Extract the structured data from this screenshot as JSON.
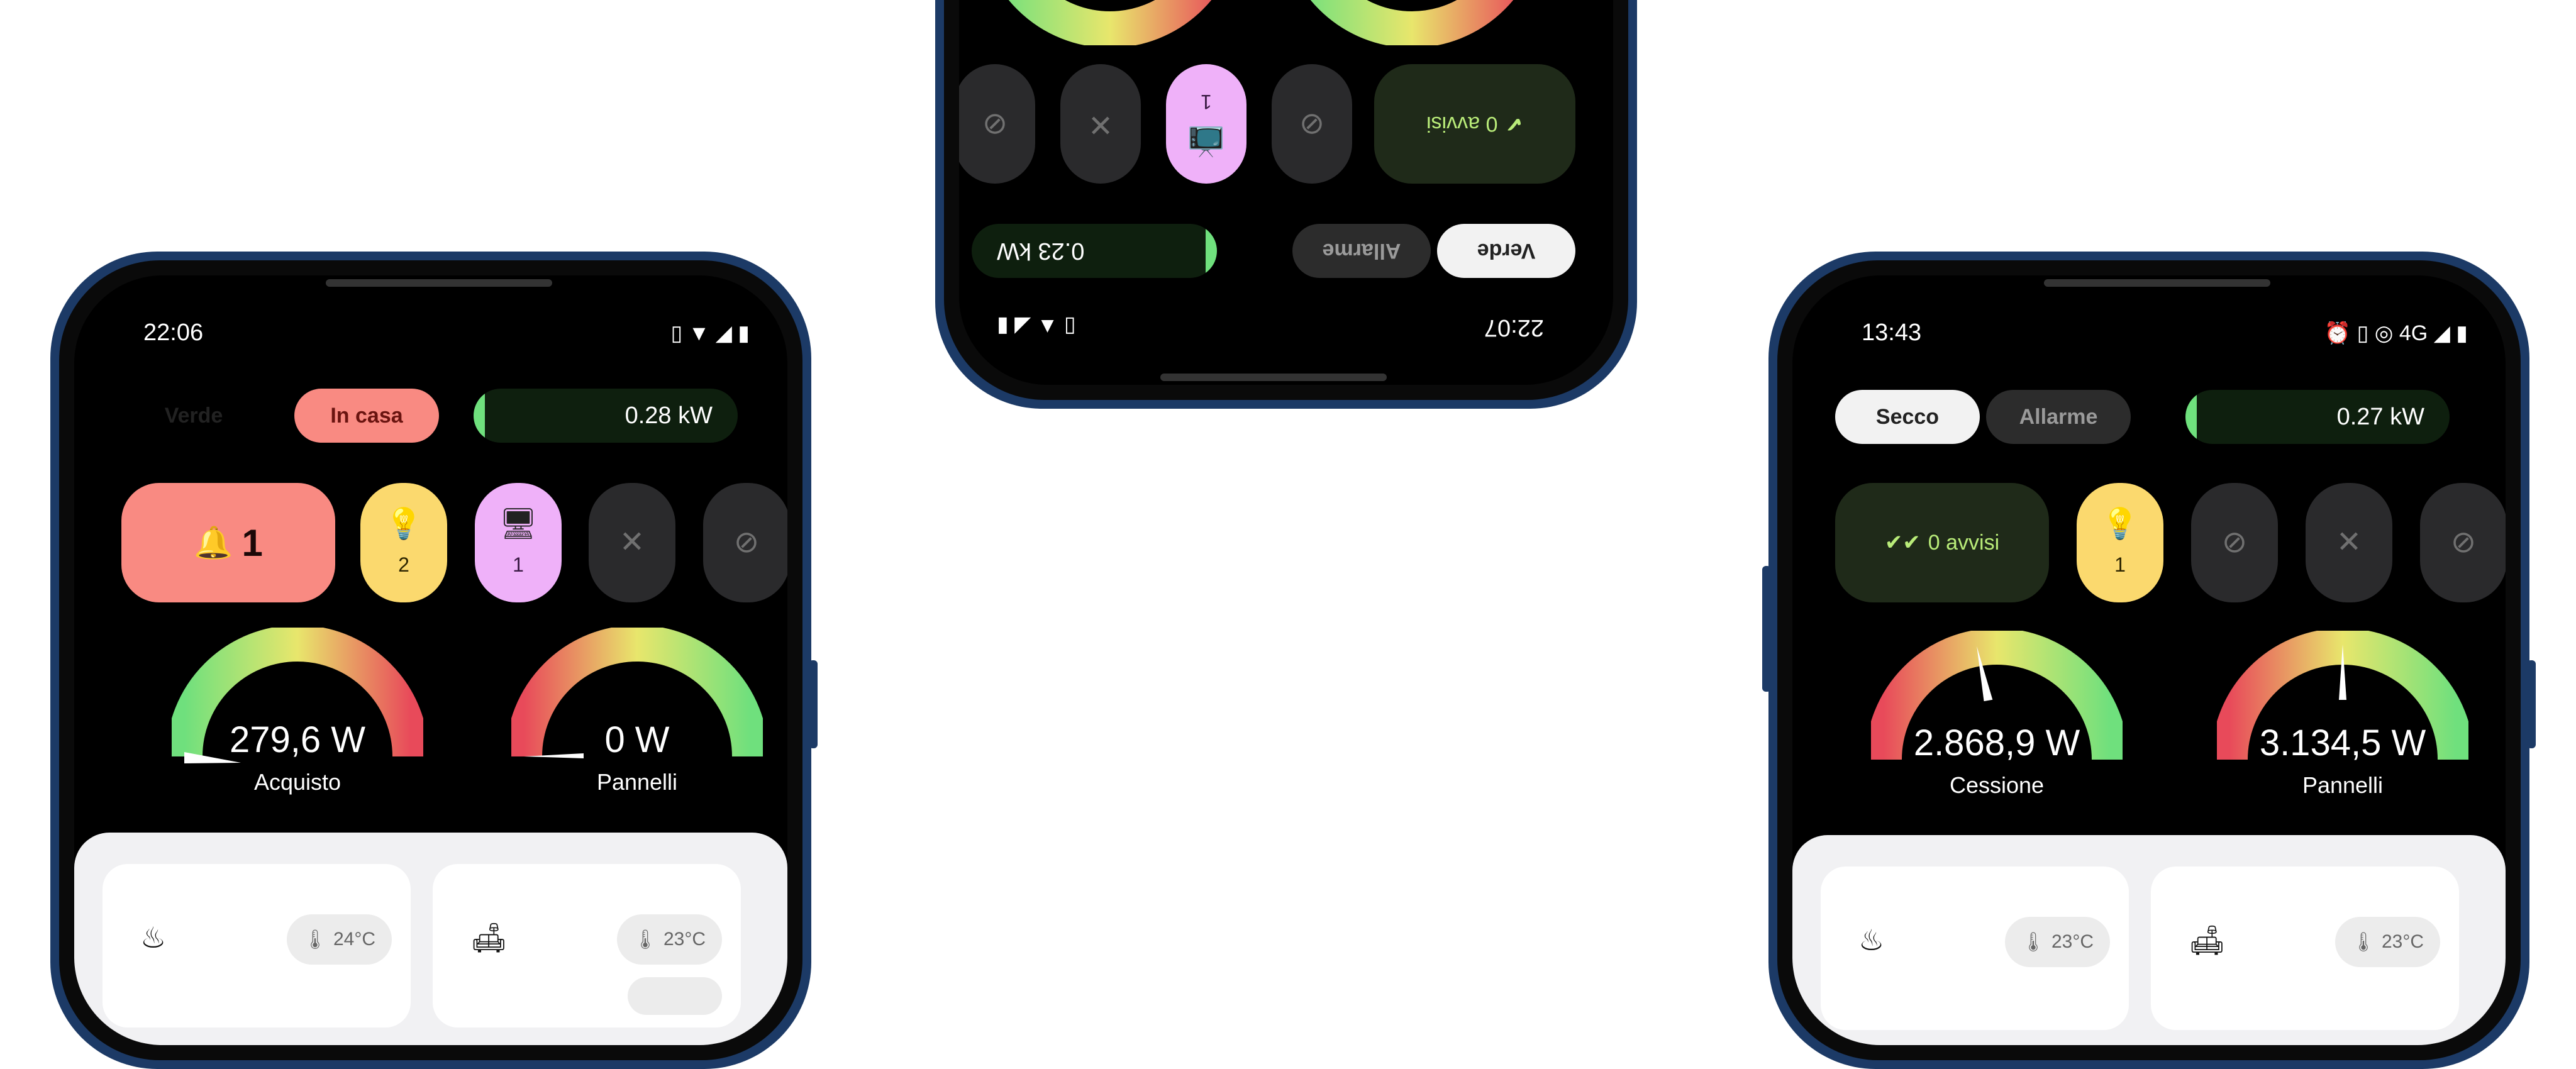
{
  "left_phone": {
    "status": {
      "time": "22:06",
      "right_icons": "▯ ▼ ◢ ▮"
    },
    "mode_pill": "Verde",
    "state_pill": "In casa",
    "power": "0.28 kW",
    "alert_tile": {
      "label": "1"
    },
    "tiles": [
      {
        "icon": "light-bulb-icon",
        "glyph": "💡",
        "count": "2",
        "color": "#fbd96e"
      },
      {
        "icon": "tv-icon",
        "glyph": "🖥",
        "count": "1",
        "color": "#efb1f9"
      },
      {
        "icon": "no-fan-icon",
        "glyph": "✕",
        "count": "",
        "color": "#2a2a2c"
      },
      {
        "icon": "no-appliance-icon",
        "glyph": "⊘",
        "count": "",
        "color": "#2a2a2c"
      }
    ],
    "gauges": [
      {
        "value": "279,6 W",
        "label": "Acquisto",
        "level": 0.04
      },
      {
        "value": "0 W",
        "label": "Pannelli",
        "level": 0.0
      }
    ],
    "rooms": [
      {
        "icon": "kitchen-pot-icon",
        "temp": "24°C"
      },
      {
        "icon": "sofa-icon",
        "temp": "23°C"
      }
    ]
  },
  "middle_phone": {
    "status": {
      "time": "22:07",
      "right_icons": "▯ ▲ ◢ ▮"
    },
    "mode_pill": "Verde",
    "state_pill": "Allarme",
    "power": "0.23 kW",
    "alert_tile": {
      "label": "0 avvisi"
    },
    "tiles": [
      {
        "icon": "no-light-icon",
        "glyph": "⊘",
        "count": "",
        "color": "#2a2a2c"
      },
      {
        "icon": "tv-icon",
        "glyph": "📺",
        "count": "1",
        "color": "#efb1f9"
      },
      {
        "icon": "no-fan-icon",
        "glyph": "✕",
        "count": "",
        "color": "#2a2a2c"
      },
      {
        "icon": "no-appliance-icon",
        "glyph": "⊘",
        "count": "",
        "color": "#2a2a2c"
      }
    ]
  },
  "right_phone": {
    "status": {
      "time": "13:43",
      "right_icons": "⏰ ▯ ◎ 4G ◢ ▮"
    },
    "mode_pill": "Secco",
    "state_pill": "Allarme",
    "power": "0.27 kW",
    "alert_tile": {
      "label": "0 avvisi"
    },
    "tiles": [
      {
        "icon": "light-bulb-icon",
        "glyph": "💡",
        "count": "1",
        "color": "#fbd96e"
      },
      {
        "icon": "no-tv-icon",
        "glyph": "⊘",
        "count": "",
        "color": "#2a2a2c"
      },
      {
        "icon": "no-fan-icon",
        "glyph": "✕",
        "count": "",
        "color": "#2a2a2c"
      },
      {
        "icon": "no-appliance-icon",
        "glyph": "⊘",
        "count": "",
        "color": "#2a2a2c"
      }
    ],
    "gauges": [
      {
        "value": "2.868,9 W",
        "label": "Cessione",
        "level": 0.55
      },
      {
        "value": "3.134,5 W",
        "label": "Pannelli",
        "level": 0.48
      }
    ],
    "rooms": [
      {
        "icon": "kitchen-pot-icon",
        "temp": "23°C"
      },
      {
        "icon": "sofa-icon",
        "temp": "23°C"
      }
    ]
  },
  "colors": {
    "frame": "#1c3a66",
    "accent_green": "#6fe07d",
    "accent_red": "#f98a82",
    "accent_yellow": "#fbd96e",
    "accent_pink": "#efb1f9"
  }
}
